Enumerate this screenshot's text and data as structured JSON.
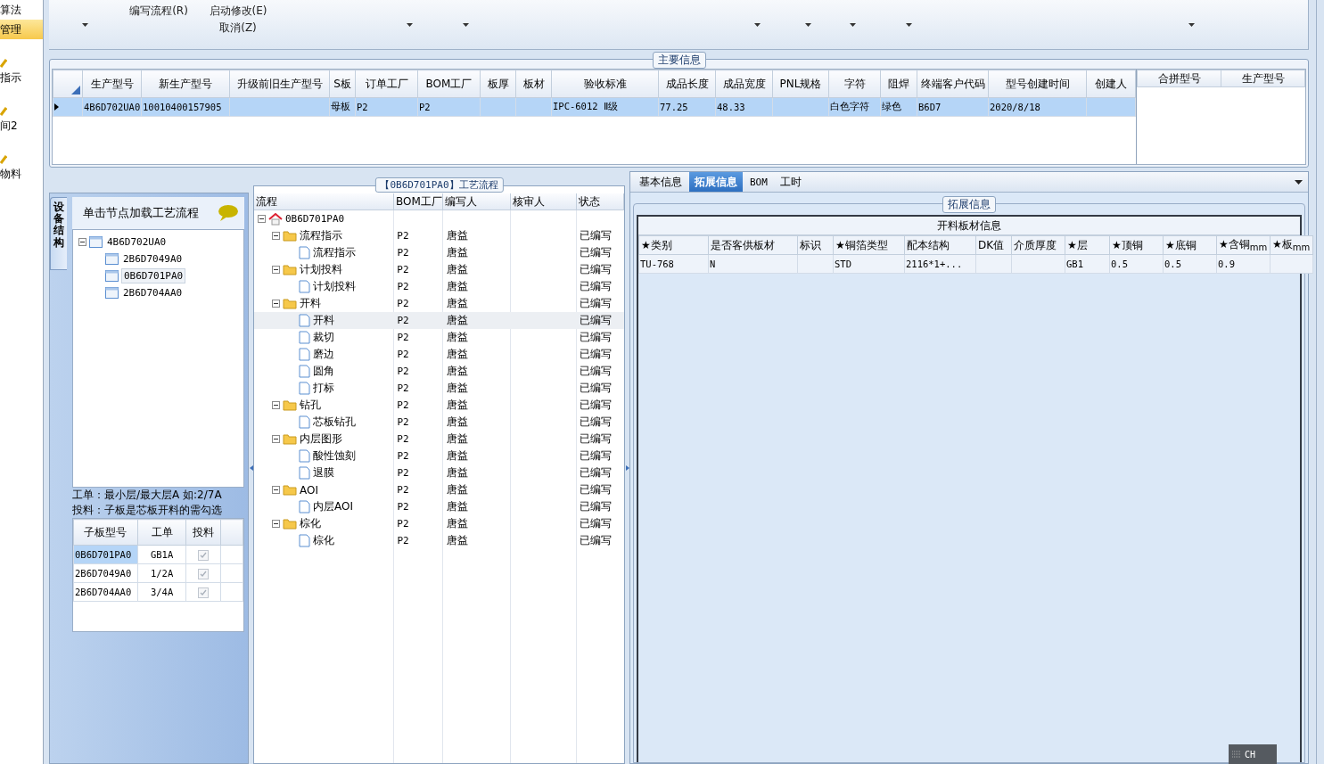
{
  "sidebar": {
    "items": [
      {
        "label": "算法",
        "selected": false
      },
      {
        "label": "管理",
        "selected": true
      },
      {
        "label": "指示",
        "selected": false
      },
      {
        "label": "间2",
        "selected": false
      },
      {
        "label": "物料",
        "selected": false
      }
    ]
  },
  "toolbar": {
    "buttons": [
      {
        "label": "编写流程(R)"
      },
      {
        "label": "启动修改(E)"
      },
      {
        "label": "取消(Z)"
      }
    ]
  },
  "main_info": {
    "title": "主要信息",
    "columns": [
      "生产型号",
      "新生产型号",
      "升级前旧生产型号",
      "S板",
      "订单工厂",
      "BOM工厂",
      "板厚",
      "板材",
      "验收标准",
      "成品长度",
      "成品宽度",
      "PNL规格",
      "字符",
      "阻焊",
      "终端客户代码",
      "型号创建时间",
      "创建人"
    ],
    "rows": [
      {
        "selected": true,
        "cells": [
          "4B6D702UA0",
          "10010400157905",
          "",
          "母板",
          "P2",
          "P2",
          "",
          "",
          "IPC-6012 Ⅱ级",
          "77.25",
          "48.33",
          "",
          "白色字符",
          "绿色",
          "B6D7",
          "2020/8/18",
          ""
        ]
      }
    ],
    "merge_columns": [
      "合拼型号",
      "生产型号"
    ]
  },
  "structure_panel": {
    "tab": "设备结构",
    "hint": "单击节点加载工艺流程",
    "tree": [
      {
        "label": "4B6D702UA0",
        "selected": false,
        "expanded": true,
        "children": [
          {
            "label": "2B6D7049A0",
            "selected": false
          },
          {
            "label": "0B6D701PA0",
            "selected": true
          },
          {
            "label": "2B6D704AA0",
            "selected": false
          }
        ]
      }
    ],
    "notes": [
      "工单：最小层/最大层A 如:2/7A",
      "投料：子板是芯板开料的需勾选"
    ],
    "sub_columns": [
      "子板型号",
      "工单",
      "投料"
    ],
    "sub_rows": [
      {
        "model": "0B6D701PA0",
        "order": "GB1A",
        "checked": true,
        "selected": true
      },
      {
        "model": "2B6D7049A0",
        "order": "1/2A",
        "checked": true,
        "selected": false
      },
      {
        "model": "2B6D704AA0",
        "order": "3/4A",
        "checked": true,
        "selected": false
      }
    ]
  },
  "process_panel": {
    "title": "【0B6D701PA0】工艺流程",
    "columns": [
      "流程",
      "BOM工厂",
      "编写人",
      "核审人",
      "状态"
    ],
    "tree": [
      {
        "kind": "root",
        "label": "0B6D701PA0",
        "expanded": true,
        "selected": false,
        "children": [
          {
            "kind": "folder",
            "label": "流程指示",
            "bom": "P2",
            "author": "唐益",
            "status": "已编写",
            "expanded": true,
            "selected": false,
            "children": [
              {
                "kind": "step",
                "label": "流程指示",
                "bom": "P2",
                "author": "唐益",
                "status": "已编写",
                "selected": false
              }
            ]
          },
          {
            "kind": "folder",
            "label": "计划投料",
            "bom": "P2",
            "author": "唐益",
            "status": "已编写",
            "expanded": true,
            "selected": false,
            "children": [
              {
                "kind": "step",
                "label": "计划投料",
                "bom": "P2",
                "author": "唐益",
                "status": "已编写",
                "selected": false
              }
            ]
          },
          {
            "kind": "folder",
            "label": "开料",
            "bom": "P2",
            "author": "唐益",
            "status": "已编写",
            "expanded": true,
            "selected": false,
            "children": [
              {
                "kind": "step",
                "label": "开料",
                "bom": "P2",
                "author": "唐益",
                "status": "已编写",
                "selected": true
              },
              {
                "kind": "step",
                "label": "裁切",
                "bom": "P2",
                "author": "唐益",
                "status": "已编写",
                "selected": false
              },
              {
                "kind": "step",
                "label": "磨边",
                "bom": "P2",
                "author": "唐益",
                "status": "已编写",
                "selected": false
              },
              {
                "kind": "step",
                "label": "圆角",
                "bom": "P2",
                "author": "唐益",
                "status": "已编写",
                "selected": false
              },
              {
                "kind": "step",
                "label": "打标",
                "bom": "P2",
                "author": "唐益",
                "status": "已编写",
                "selected": false
              }
            ]
          },
          {
            "kind": "folder",
            "label": "钻孔",
            "bom": "P2",
            "author": "唐益",
            "status": "已编写",
            "expanded": true,
            "selected": false,
            "children": [
              {
                "kind": "step",
                "label": "芯板钻孔",
                "bom": "P2",
                "author": "唐益",
                "status": "已编写",
                "selected": false
              }
            ]
          },
          {
            "kind": "folder",
            "label": "内层图形",
            "bom": "P2",
            "author": "唐益",
            "status": "已编写",
            "expanded": true,
            "selected": false,
            "children": [
              {
                "kind": "step",
                "label": "酸性蚀刻",
                "bom": "P2",
                "author": "唐益",
                "status": "已编写",
                "selected": false
              },
              {
                "kind": "step",
                "label": "退膜",
                "bom": "P2",
                "author": "唐益",
                "status": "已编写",
                "selected": false
              }
            ]
          },
          {
            "kind": "folder",
            "label": "AOI",
            "bom": "P2",
            "author": "唐益",
            "status": "已编写",
            "expanded": true,
            "selected": false,
            "children": [
              {
                "kind": "step",
                "label": "内层AOI",
                "bom": "P2",
                "author": "唐益",
                "status": "已编写",
                "selected": false
              }
            ]
          },
          {
            "kind": "folder",
            "label": "棕化",
            "bom": "P2",
            "author": "唐益",
            "status": "已编写",
            "expanded": true,
            "selected": false,
            "children": [
              {
                "kind": "step",
                "label": "棕化",
                "bom": "P2",
                "author": "唐益",
                "status": "已编写",
                "selected": false
              }
            ]
          }
        ]
      }
    ]
  },
  "detail_panel": {
    "tabs": [
      {
        "label": "基本信息",
        "selected": false
      },
      {
        "label": "拓展信息",
        "selected": true
      },
      {
        "label": "BOM",
        "selected": false
      },
      {
        "label": "工时",
        "selected": false
      }
    ],
    "group_title": "拓展信息",
    "table_title": "开料板材信息",
    "columns": [
      "★类别",
      "是否客供板材",
      "标识",
      "★铜箔类型",
      "配本结构",
      "DK值",
      "介质厚度",
      "★层",
      "★顶铜",
      "★底铜",
      "★含铜$_{mm}$",
      "★板$_{mm}$"
    ],
    "rows": [
      [
        "TU-768",
        "N",
        "",
        "STD",
        "2116*1+...",
        "",
        "",
        "GB1",
        "0.5",
        "0.5",
        "0.9",
        ""
      ]
    ]
  },
  "ime_indicator": "CH"
}
